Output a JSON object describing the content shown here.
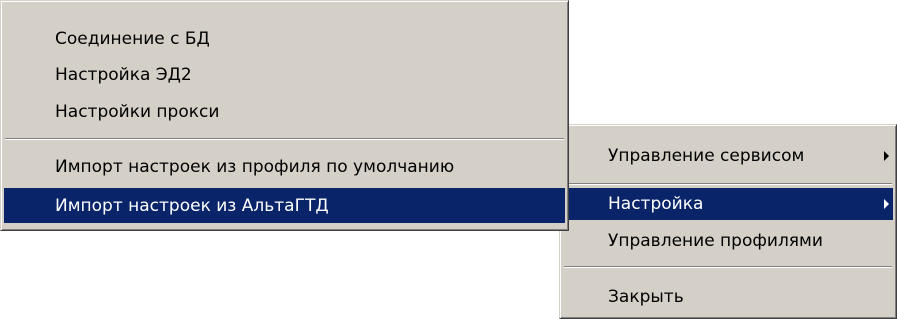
{
  "submenu": {
    "items": [
      {
        "label": "Соединение с БД"
      },
      {
        "label": "Настройка ЭД2"
      },
      {
        "label": "Настройки прокси"
      },
      {
        "label": "Импорт настроек из профиля по умолчанию"
      },
      {
        "label": "Импорт настроек из АльтаГТД"
      }
    ]
  },
  "main_menu": {
    "items": [
      {
        "label": "Управление сервисом",
        "submenu_arrow": "submenu-arrow-icon"
      },
      {
        "label": "Настройка",
        "submenu_arrow": "submenu-arrow-icon"
      },
      {
        "label": "Управление профилями"
      },
      {
        "label": "Закрыть"
      }
    ]
  },
  "colors": {
    "menu_background": "#d4d0c8",
    "selection_background": "#0a246a",
    "selection_text": "#ffffff"
  }
}
